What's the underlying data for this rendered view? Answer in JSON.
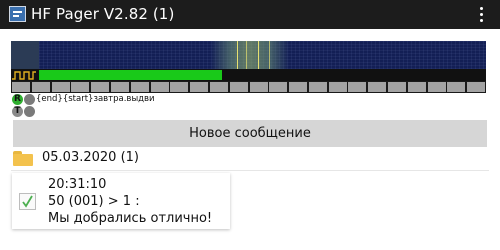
{
  "app": {
    "title": "HF Pager V2.82 (1)",
    "icon": "hf-pager-app-icon",
    "menu_icon": "overflow-menu-icon"
  },
  "waterfall": {
    "background_color": "#131f55",
    "signal_color": "#e6e070"
  },
  "level": {
    "fill_fraction": 0.41,
    "color": "#19c919"
  },
  "segments": {
    "count": 24,
    "color": "#a3a3a3"
  },
  "indicators": [
    {
      "letter": "R",
      "color": "#2fae2f",
      "second_color": "#7a7a7a"
    },
    {
      "letter": "T",
      "color": "#8a8a8a",
      "second_color": "#7a7a7a"
    }
  ],
  "status_text": "{end}{start}завтра.выдви",
  "new_message_button": "Новое сообщение",
  "folder": {
    "date_label": "05.03.2020 (1)",
    "icon": "folder-icon"
  },
  "messages": [
    {
      "time": "20:31:10",
      "header": "50 (001) > 1 :",
      "text": "Мы добрались отлично!",
      "icon": "checkmark-icon"
    }
  ]
}
